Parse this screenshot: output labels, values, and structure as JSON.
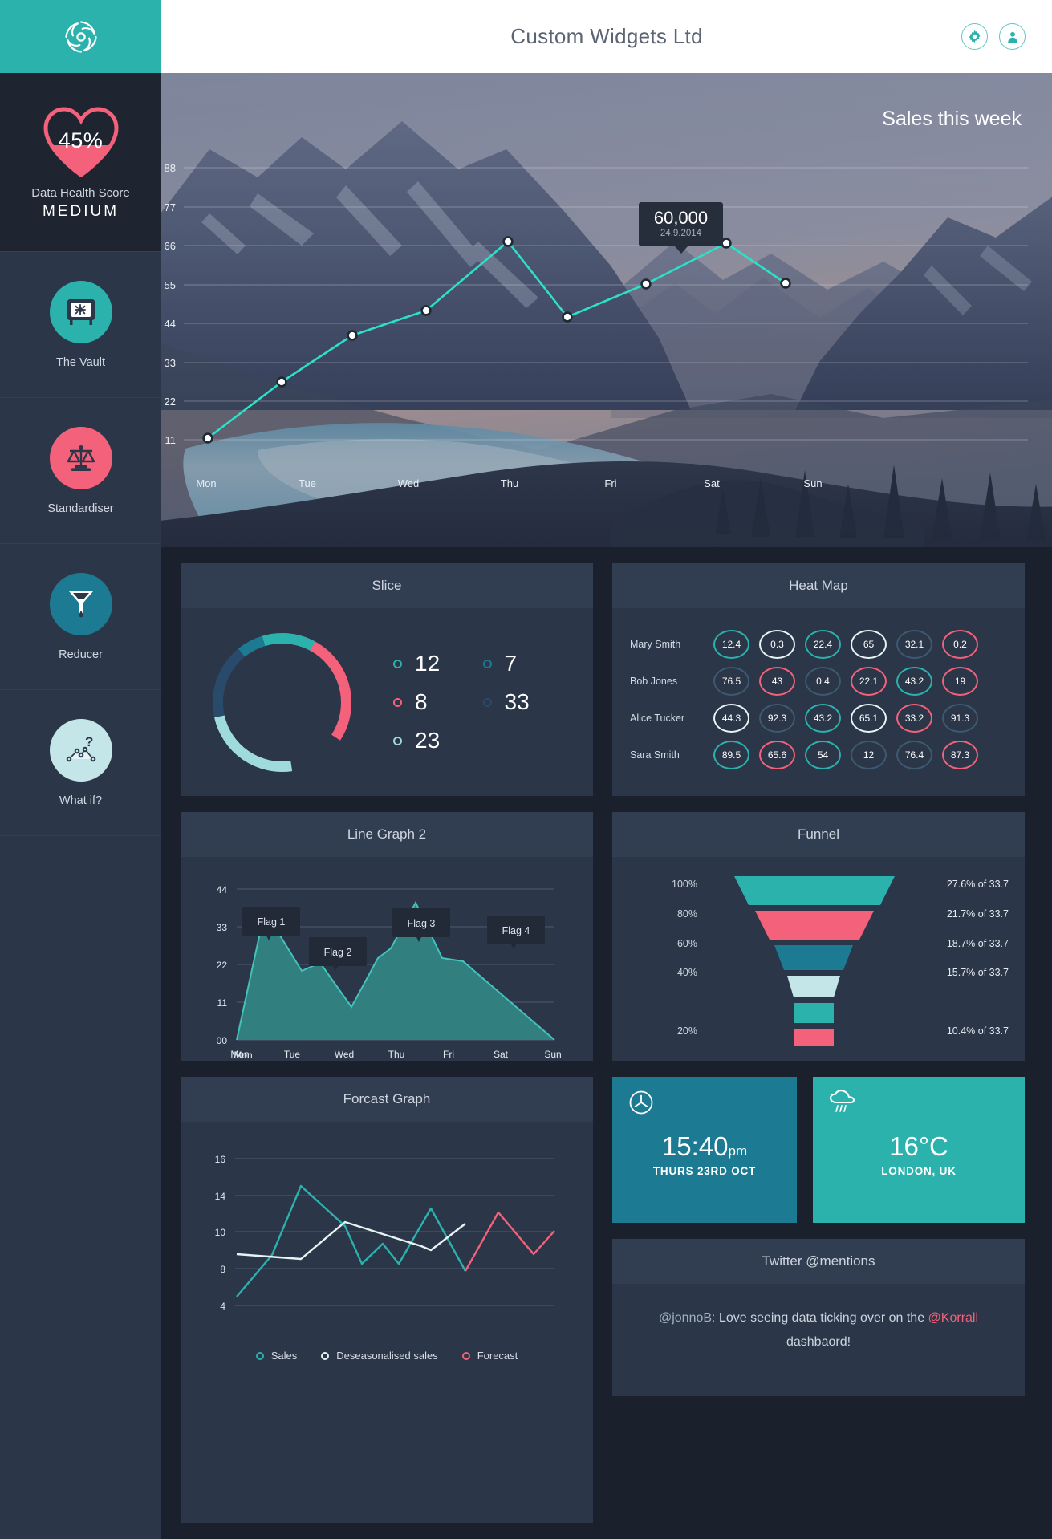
{
  "header": {
    "title": "Custom Widgets Ltd",
    "settings_icon": "gear-icon",
    "account_icon": "user-icon"
  },
  "sidebar": {
    "logo_icon": "spiral-logo-icon",
    "health": {
      "percent": "45%",
      "percent_value": 45,
      "label": "Data Health Score",
      "status": "MEDIUM",
      "fill_color": "#f4617a"
    },
    "items": [
      {
        "label": "The Vault",
        "icon": "vault-safe-icon",
        "color": "#2bb2ad"
      },
      {
        "label": "Standardiser",
        "icon": "scales-icon",
        "color": "#f4617a"
      },
      {
        "label": "Reducer",
        "icon": "funnel-icon",
        "color": "#1c7b92"
      },
      {
        "label": "What if?",
        "icon": "question-nodes-icon",
        "color": "#c5e6e8"
      }
    ]
  },
  "hero": {
    "title": "Sales this week",
    "tooltip": {
      "value": "60,000",
      "date": "24.9.2014"
    }
  },
  "panels": {
    "slice": "Slice",
    "heat_map": "Heat Map",
    "line_graph_2": "Line Graph 2",
    "funnel": "Funnel",
    "forecast": "Forcast Graph",
    "twitter": "Twitter @mentions"
  },
  "slice": {
    "legend": [
      {
        "value": "12",
        "color": "#2bb2ad"
      },
      {
        "value": "7",
        "color": "#1c7b92"
      },
      {
        "value": "8",
        "color": "#f4617a"
      },
      {
        "value": "33",
        "color": "#2a4a6b"
      },
      {
        "value": "23",
        "color": "#9fdbdd"
      }
    ]
  },
  "heat_map": {
    "rows": [
      {
        "name": "Mary Smith",
        "values": [
          "12.4",
          "0.3",
          "22.4",
          "65",
          "32.1",
          "0.2"
        ],
        "colors": [
          "#2bb2ad",
          "#e8f3f4",
          "#2bb2ad",
          "#e8f3f4",
          "#3d5a72",
          "#f4617a"
        ]
      },
      {
        "name": "Bob Jones",
        "values": [
          "76.5",
          "43",
          "0.4",
          "22.1",
          "43.2",
          "19"
        ],
        "colors": [
          "#3d5a72",
          "#f4617a",
          "#3d5a72",
          "#f4617a",
          "#2bb2ad",
          "#f4617a"
        ]
      },
      {
        "name": "Alice Tucker",
        "values": [
          "44.3",
          "92.3",
          "43.2",
          "65.1",
          "33.2",
          "91.3"
        ],
        "colors": [
          "#e8f3f4",
          "#3d5a72",
          "#2bb2ad",
          "#e8f3f4",
          "#f4617a",
          "#3d5a72"
        ]
      },
      {
        "name": "Sara Smith",
        "values": [
          "89.5",
          "65.6",
          "54",
          "12",
          "76.4",
          "87.3"
        ],
        "colors": [
          "#2bb2ad",
          "#f4617a",
          "#2bb2ad",
          "#3d5a72",
          "#3d5a72",
          "#f4617a"
        ]
      }
    ]
  },
  "funnel": {
    "left_labels": [
      "100%",
      "80%",
      "60%",
      "40%",
      "20%"
    ],
    "right_labels": [
      "27.6% of 33.7",
      "21.7% of 33.7",
      "18.7% of 33.7",
      "15.7% of 33.7",
      "10.4% of 33.7"
    ]
  },
  "clock": {
    "time": "15:40",
    "suffix": "pm",
    "date": "THURS 23RD OCT",
    "icon": "clock-icon"
  },
  "weather": {
    "temperature": "16°C",
    "location": "LONDON, UK",
    "icon": "rain-cloud-icon"
  },
  "twitter": {
    "user": "@jonnoB:",
    "text_before": " Love seeing data ticking over on the ",
    "mention": "@Korrall",
    "text_after": " dashbaord!"
  },
  "forecast_legend": [
    {
      "label": "Sales",
      "color": "#2bb2ad"
    },
    {
      "label": "Deseasonalised sales",
      "color": "#e8f3f4"
    },
    {
      "label": "Forecast",
      "color": "#f4617a"
    }
  ],
  "chart_data": [
    {
      "id": "hero-sales-line",
      "type": "line",
      "title": "Sales this week",
      "categories": [
        "Mon",
        "Tue",
        "Wed",
        "Thu",
        "Fri",
        "Sat",
        "Sun"
      ],
      "x": [
        0,
        0.5,
        1,
        1.5,
        2,
        2.5,
        3,
        3.5,
        4
      ],
      "values": [
        11,
        27,
        39,
        47,
        66,
        46,
        55,
        66,
        55
      ],
      "ytick_labels": [
        "88",
        "77",
        "66",
        "55",
        "44",
        "33",
        "22",
        "11"
      ],
      "yticks": [
        88,
        77,
        66,
        55,
        44,
        33,
        22,
        11
      ],
      "ylim": [
        0,
        94
      ],
      "grid": true,
      "line_color": "#2ee0c8",
      "marker": "open-circle",
      "annotation": {
        "value": "60,000",
        "date": "24.9.2014",
        "at_index": 4
      }
    },
    {
      "id": "line-graph-2",
      "type": "area",
      "title": "Line Graph 2",
      "categories": [
        "Mon",
        "Tue",
        "Wed",
        "Thu",
        "Fri",
        "Sat",
        "Sun"
      ],
      "ytick_labels": [
        "00",
        "11",
        "22",
        "33",
        "44"
      ],
      "yticks": [
        0,
        11,
        22,
        33,
        44
      ],
      "ylim": [
        0,
        44
      ],
      "values": [
        0,
        24,
        13.5,
        15,
        9.5,
        24,
        26.5,
        40,
        24,
        23.5,
        0
      ],
      "x": [
        0,
        0.6,
        1.25,
        1.65,
        2.3,
        2.85,
        3.1,
        3.6,
        4.15,
        4.55,
        6
      ],
      "grid": true,
      "line_color": "#2bb2ad",
      "fill_color": "#31807f",
      "flags": [
        "Flag 1",
        "Flag 2",
        "Flag 3",
        "Flag 4"
      ]
    },
    {
      "id": "slice-donut",
      "type": "pie",
      "title": "Slice",
      "labels": [
        "12",
        "7",
        "8",
        "33",
        "23"
      ],
      "values": [
        12,
        7,
        8,
        33,
        23
      ],
      "colors": [
        "#2bb2ad",
        "#1c7b92",
        "#f4617a",
        "#2a4a6b",
        "#9fdbdd"
      ],
      "donut": true,
      "legend": "right"
    },
    {
      "id": "heat-map",
      "type": "heatmap",
      "title": "Heat Map",
      "rows": [
        "Mary Smith",
        "Bob Jones",
        "Alice Tucker",
        "Sara Smith"
      ],
      "values": [
        [
          12.4,
          0.3,
          22.4,
          65,
          32.1,
          0.2
        ],
        [
          76.5,
          43,
          0.4,
          22.1,
          43.2,
          19
        ],
        [
          44.3,
          92.3,
          43.2,
          65.1,
          33.2,
          91.3
        ],
        [
          89.5,
          65.6,
          54,
          12,
          76.4,
          87.3
        ]
      ]
    },
    {
      "id": "funnel-chart",
      "type": "funnel",
      "title": "Funnel",
      "stages": [
        "100%",
        "80%",
        "60%",
        "40%",
        "",
        "20%"
      ],
      "values": [
        100,
        80,
        62,
        44,
        35,
        30
      ],
      "annotations": [
        "27.6% of 33.7",
        "21.7% of 33.7",
        "18.7% of 33.7",
        "15.7% of 33.7",
        "10.4% of 33.7"
      ],
      "colors": [
        "#2bb2ad",
        "#f4617a",
        "#1c7b92",
        "#c5e6e8",
        "#2bb2ad",
        "#f4617a"
      ]
    },
    {
      "id": "forecast-graph",
      "type": "line",
      "title": "Forcast Graph",
      "ytick_labels": [
        "4",
        "8",
        "10",
        "14",
        "16"
      ],
      "yticks": [
        4,
        8,
        10,
        14,
        16
      ],
      "ylim": [
        3,
        17
      ],
      "grid": true,
      "series": [
        {
          "name": "Sales",
          "color": "#2bb2ad",
          "x": [
            0,
            1,
            2,
            3,
            4,
            5,
            6,
            7,
            8
          ],
          "values": [
            7.0,
            9.3,
            14.7,
            10.5,
            8.8,
            9.7,
            8.8,
            13.5,
            8.3
          ]
        },
        {
          "name": "Deseasonalised sales",
          "color": "#e8f3f4",
          "x": [
            0,
            1,
            2,
            3,
            4,
            5,
            6,
            7
          ],
          "values": [
            9.3,
            9.1,
            9.0,
            10.2,
            10.0,
            9.6,
            9.4,
            10.6
          ]
        },
        {
          "name": "Forecast",
          "color": "#f4617a",
          "x": [
            8,
            9,
            10,
            11
          ],
          "values": [
            8.3,
            12.6,
            8.9,
            9.7
          ]
        }
      ]
    }
  ]
}
